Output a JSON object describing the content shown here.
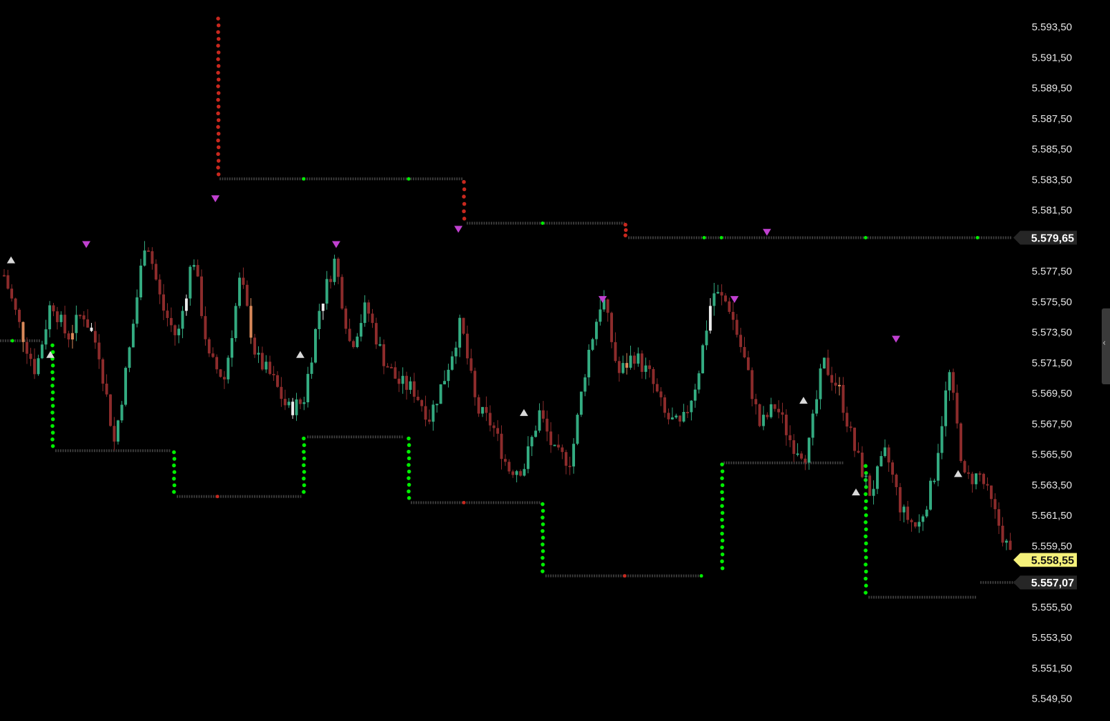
{
  "chart_data": {
    "type": "candlestick",
    "title": "",
    "xlabel": "",
    "ylabel": "",
    "ylim": [
      5549.5,
      5595.5
    ],
    "y_ticks": [
      "5.593,50",
      "5.591,50",
      "5.589,50",
      "5.587,50",
      "5.585,50",
      "5.583,50",
      "5.581,50",
      "5.577,50",
      "5.575,50",
      "5.573,50",
      "5.571,50",
      "5.569,50",
      "5.567,50",
      "5.565,50",
      "5.563,50",
      "5.561,50",
      "5.559,50",
      "5.555,50",
      "5.553,50",
      "5.551,50",
      "5.549,50"
    ],
    "y_tick_values": [
      5593.5,
      5591.5,
      5589.5,
      5587.5,
      5585.5,
      5583.5,
      5581.5,
      5577.5,
      5575.5,
      5573.5,
      5571.5,
      5569.5,
      5567.5,
      5565.5,
      5563.5,
      5561.5,
      5559.5,
      5555.5,
      5553.5,
      5551.5,
      5549.5
    ],
    "grid": false,
    "price_path": [
      5577.2,
      5573.8,
      5570.9,
      5575.6,
      5573.1,
      5574.8,
      5572.3,
      5566.2,
      5572.6,
      5579.9,
      5575.2,
      5573.0,
      5578.6,
      5571.7,
      5570.4,
      5577.1,
      5571.8,
      5570.5,
      5568.4,
      5568.9,
      5574.9,
      5578.2,
      5572.5,
      5575.2,
      5571.9,
      5570.2,
      5569.7,
      5567.9,
      5570.6,
      5574.1,
      5568.4,
      5567.4,
      5564.5,
      5564.6,
      5568.2,
      5565.4,
      5565.1,
      5571.7,
      5575.9,
      5570.7,
      5572.0,
      5570.6,
      5567.9,
      5567.2,
      5570.4,
      5576.1,
      5575.3,
      5571.7,
      5567.3,
      5568.7,
      5566.2,
      5565.4,
      5571.5,
      5569.8,
      5565.8,
      5562.9,
      5565.6,
      5561.7,
      5560.6,
      5563.7,
      5570.9,
      5563.8,
      5564.1,
      5561.3,
      5558.55
    ],
    "candle_colors": {
      "up": "#33aa80",
      "down": "#8c2b2b",
      "doji": "#e8e8e8",
      "neutral": "#d9895a"
    },
    "last_price": "5.558,55",
    "reference_level_1": "5.579,65",
    "reference_level_2": "5.557,07",
    "colors": {
      "background": "#000000",
      "stop_up": "#00ee00",
      "stop_down": "#c8281e",
      "level_line": "#3a3a3a",
      "marker_high": "#c040d0",
      "marker_low": "#d9d9d9",
      "last_price_bg": "#f5f17a",
      "badge_bg": "#262626",
      "axis_text": "#e6e6e6"
    },
    "up_markers_y": [
      5578.2,
      5572.0,
      5572.0,
      5568.2,
      5569.0,
      5563.0,
      5564.2
    ],
    "down_markers_y": [
      5582.2,
      5579.2,
      5579.2,
      5580.2,
      5575.6,
      5575.6,
      5580.0,
      5573.0
    ]
  }
}
